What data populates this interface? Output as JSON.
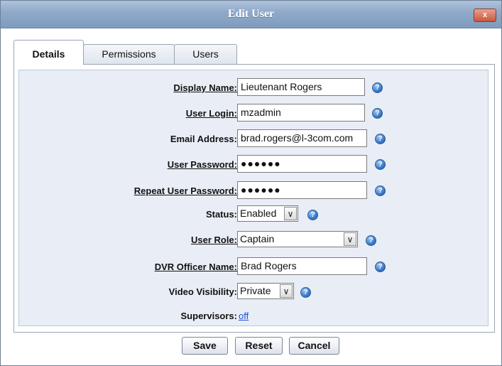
{
  "dialog": {
    "title": "Edit User",
    "close_label": "x"
  },
  "tabs": [
    {
      "label": "Details",
      "active": true
    },
    {
      "label": "Permissions",
      "active": false
    },
    {
      "label": "Users",
      "active": false
    }
  ],
  "form": {
    "display_name": {
      "label": "Display Name:",
      "value": "Lieutenant Rogers"
    },
    "user_login": {
      "label": "User Login:",
      "value": "mzadmin"
    },
    "email": {
      "label": "Email Address:",
      "value": "brad.rogers@l-3com.com"
    },
    "password": {
      "label": "User Password:",
      "value": "●●●●●●"
    },
    "repeat_password": {
      "label": "Repeat User Password:",
      "value": "●●●●●●"
    },
    "status": {
      "label": "Status:",
      "value": "Enabled"
    },
    "user_role": {
      "label": "User Role:",
      "value": "Captain"
    },
    "dvr_officer_name": {
      "label": "DVR Officer Name:",
      "value": "Brad Rogers"
    },
    "video_visibility": {
      "label": "Video Visibility:",
      "value": "Private"
    },
    "supervisors": {
      "label": "Supervisors:",
      "value": "off"
    }
  },
  "help_icon_glyph": "?",
  "dropdown_glyph": "∨",
  "buttons": {
    "save": "Save",
    "reset": "Reset",
    "cancel": "Cancel"
  },
  "colors": {
    "title_bar": "#8ea8c8",
    "form_background": "#e9eef6",
    "link": "#1a4fd6",
    "close_button": "#c8583e"
  }
}
